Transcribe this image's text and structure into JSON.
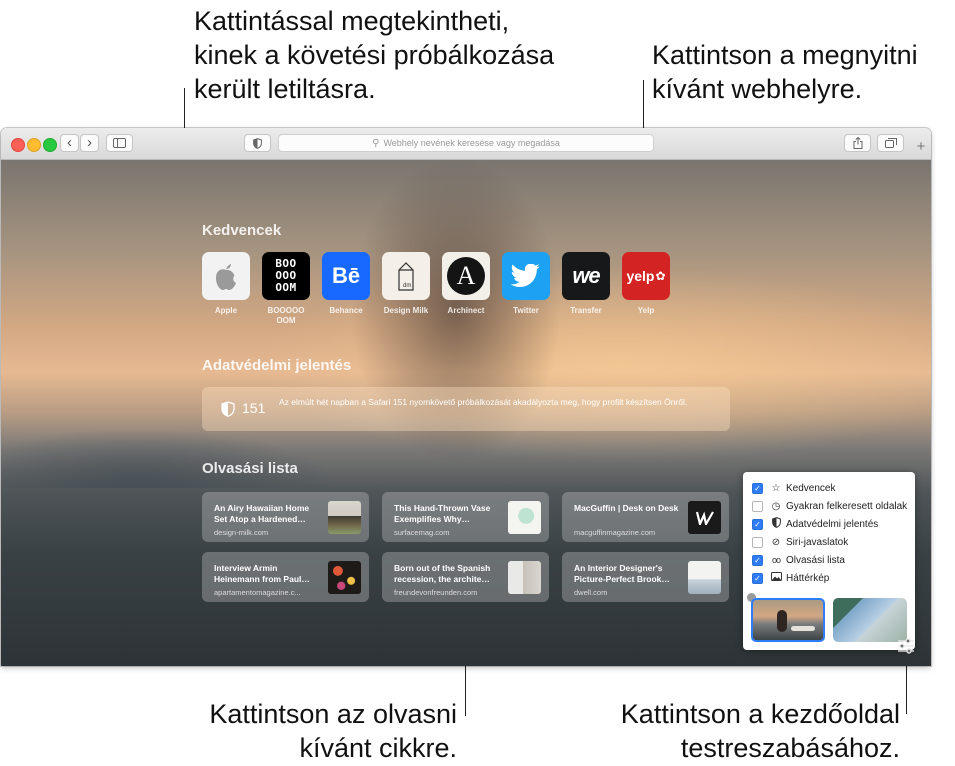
{
  "callouts": {
    "top_left": "Kattintással megtekintheti,\nkinek a követési próbálkozása\nkerült letiltásra.",
    "top_right": "Kattintson a megnyitni\nkívánt webhelyre.",
    "bottom_left": "Kattintson az olvasni\nkívánt cikkre.",
    "bottom_right": "Kattintson a kezdőoldal\ntestreszabásához."
  },
  "toolbar": {
    "back": "‹",
    "forward": "›",
    "search_placeholder": "Webhely nevének keresése vagy megadása",
    "new_tab": "+"
  },
  "favorites": {
    "title": "Kedvencek",
    "items": [
      {
        "label": "Apple",
        "icon": "apple-logo-icon",
        "bg": "#f2f2f2"
      },
      {
        "label": "BOOOOO OOM",
        "icon": "boooooom-logo-icon",
        "bg": "#000000",
        "text": "BOO\nOOO\nOOM"
      },
      {
        "label": "Behance",
        "icon": "behance-logo-icon",
        "bg": "#1769ff",
        "text": "Bē"
      },
      {
        "label": "Design Milk",
        "icon": "design-milk-logo-icon",
        "bg": "#f4efe9"
      },
      {
        "label": "Archinect",
        "icon": "archinect-logo-icon",
        "bg": "#f3f0ea",
        "text": "A"
      },
      {
        "label": "Twitter",
        "icon": "twitter-bird-icon",
        "bg": "#1da1f2"
      },
      {
        "label": "Transfer",
        "icon": "wetransfer-logo-icon",
        "bg": "#17181a",
        "text": "we"
      },
      {
        "label": "Yelp",
        "icon": "yelp-logo-icon",
        "bg": "#d32323",
        "text": "yelp"
      }
    ]
  },
  "privacy": {
    "title": "Adatvédelmi jelentés",
    "count": "151",
    "text": "Az elmúlt hét napban a Safari 151 nyomkövető próbálkozását akadályozta meg, hogy profilt készítsen Önről."
  },
  "reading_list": {
    "title": "Olvasási lista",
    "items": [
      {
        "title": "An Airy Hawaiian Home Set Atop a Hardened…",
        "source": "design-milk.com"
      },
      {
        "title": "This Hand-Thrown Vase Exemplifies Why…",
        "source": "surfacemag.com"
      },
      {
        "title": "MacGuffin | Desk on Desk",
        "source": "macguffinmagazine.com"
      },
      {
        "title": "Interview Armin Heinemann from Paul…",
        "source": "apartamentomagazine.c..."
      },
      {
        "title": "Born out of the Spanish recession, the archite…",
        "source": "freundevonfreunden.com"
      },
      {
        "title": "An Interior Designer's Picture-Perfect Brook…",
        "source": "dwell.com"
      }
    ]
  },
  "customize": {
    "options": [
      {
        "label": "Kedvencek",
        "checked": true,
        "icon": "star-icon"
      },
      {
        "label": "Gyakran felkeresett oldalak",
        "checked": false,
        "icon": "clock-icon"
      },
      {
        "label": "Adatvédelmi jelentés",
        "checked": true,
        "icon": "shield-icon"
      },
      {
        "label": "Siri-javaslatok",
        "checked": false,
        "icon": "siri-compass-icon"
      },
      {
        "label": "Olvasási lista",
        "checked": true,
        "icon": "glasses-icon"
      },
      {
        "label": "Háttérkép",
        "checked": true,
        "icon": "image-icon"
      }
    ],
    "wallpapers": [
      "surfer-photo",
      "abstract-blue-green"
    ],
    "selected_wallpaper": 0
  },
  "colors": {
    "accent": "#2f7df6",
    "traffic_close": "#fe5f57",
    "traffic_min": "#febc2e",
    "traffic_max": "#28c840"
  }
}
